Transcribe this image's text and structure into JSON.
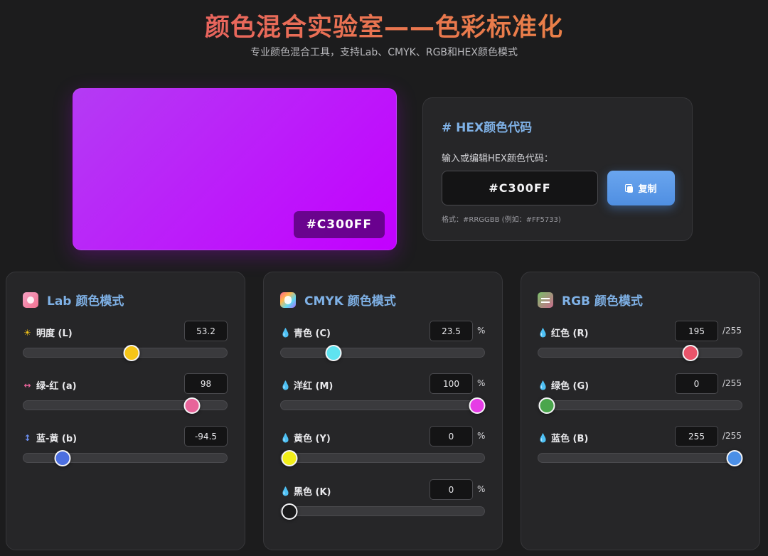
{
  "header": {
    "title": "颜色混合实验室——色彩标准化",
    "subtitle": "专业颜色混合工具，支持Lab、CMYK、RGB和HEX颜色模式"
  },
  "preview": {
    "color": "#C300FF",
    "code": "#C300FF"
  },
  "hex": {
    "heading": "# HEX颜色代码",
    "label": "输入或编辑HEX颜色代码：",
    "value": "#C300FF",
    "copy_label": "复制",
    "hint": "格式：#RRGGBB (例如：#FF5733)"
  },
  "lab": {
    "heading": "Lab 颜色模式",
    "icon": "palette-icon",
    "controls": [
      {
        "label": "明度 (L)",
        "icon": "sun-icon",
        "value": "53.2",
        "fraction": 0.532,
        "thumb_color": "#f5c518"
      },
      {
        "label": "绿-红 (a)",
        "icon": "left-right-arrow-icon",
        "value": "98",
        "fraction": 0.853,
        "thumb_color": "#e8649a"
      },
      {
        "label": "蓝-黄 (b)",
        "icon": "up-down-arrow-icon",
        "value": "-94.5",
        "fraction": 0.162,
        "thumb_color": "#4c6fe0"
      }
    ]
  },
  "cmyk": {
    "heading": "CMYK 颜色模式",
    "icon": "rainbow-icon",
    "unit": "%",
    "controls": [
      {
        "label": "青色 (C)",
        "icon": "cyan-drop-icon",
        "value": "23.5",
        "fraction": 0.235,
        "thumb_color": "#5fe3f0"
      },
      {
        "label": "洋红 (M)",
        "icon": "magenta-drop-icon",
        "value": "100",
        "fraction": 1.0,
        "thumb_color": "#e63ce6"
      },
      {
        "label": "黄色 (Y)",
        "icon": "yellow-drop-icon",
        "value": "0",
        "fraction": 0.0,
        "thumb_color": "#f2ef1a"
      },
      {
        "label": "黑色 (K)",
        "icon": "black-drop-icon",
        "value": "0",
        "fraction": 0.0,
        "thumb_color": "#1a1a1b"
      }
    ]
  },
  "rgb": {
    "heading": "RGB 颜色模式",
    "icon": "sliders-icon",
    "unit": "/255",
    "controls": [
      {
        "label": "红色 (R)",
        "icon": "red-drop-icon",
        "value": "195",
        "fraction": 0.765,
        "thumb_color": "#e9546a"
      },
      {
        "label": "绿色 (G)",
        "icon": "green-drop-icon",
        "value": "0",
        "fraction": 0.0,
        "thumb_color": "#4aa64c"
      },
      {
        "label": "蓝色 (B)",
        "icon": "blue-drop-icon",
        "value": "255",
        "fraction": 1.0,
        "thumb_color": "#4b8fe6"
      }
    ]
  }
}
